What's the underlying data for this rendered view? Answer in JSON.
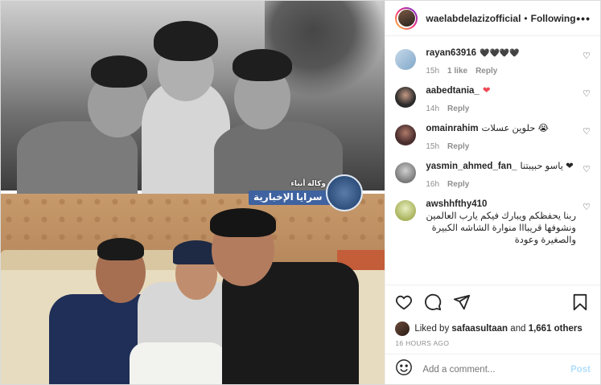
{
  "post": {
    "username": "waelabdelazizofficial",
    "separator": "•",
    "follow_status": "Following",
    "more_label": "•••"
  },
  "watermark": {
    "top_text": "وكالة أنباء",
    "main_text": "سرايا الإخبارية"
  },
  "comments": [
    {
      "user": "rayan63916",
      "text": "🖤🖤🖤🖤",
      "time": "15h",
      "likes": "1 like",
      "reply": "Reply",
      "avatar_color": "#7fa7c9"
    },
    {
      "user": "aabedtania_",
      "text": "❤",
      "time": "14h",
      "likes": "",
      "reply": "Reply",
      "avatar_color": "#2b2b2b"
    },
    {
      "user": "omainrahim",
      "text": "حلوين عسلات 😭",
      "time": "15h",
      "likes": "",
      "reply": "Reply",
      "avatar_color": "#4a2e2e"
    },
    {
      "user": "yasmin_ahmed_fan_",
      "text": "ياسو حبيبتنا ❤",
      "time": "16h",
      "likes": "",
      "reply": "Reply",
      "avatar_color": "#9a9a9a"
    },
    {
      "user": "awshhfthy410",
      "text": "ربنا يحفظكم ويبارك فيكم يارب العالمين ونشوفها قريبااا منوارة الشاشه الكبيرة والصغيرة وعودة",
      "time": "",
      "likes": "",
      "reply": "",
      "avatar_color": "#c9d27a"
    }
  ],
  "likes": {
    "prefix": "Liked by",
    "user": "safaasultaan",
    "and": "and",
    "count": "1,661 others"
  },
  "time_ago": "16 HOURS AGO",
  "add_comment": {
    "placeholder": "Add a comment...",
    "post_label": "Post"
  },
  "icons": {
    "like": "heart-icon",
    "comment": "comment-icon",
    "share": "share-icon",
    "save": "bookmark-icon",
    "emoji": "emoji-icon"
  }
}
